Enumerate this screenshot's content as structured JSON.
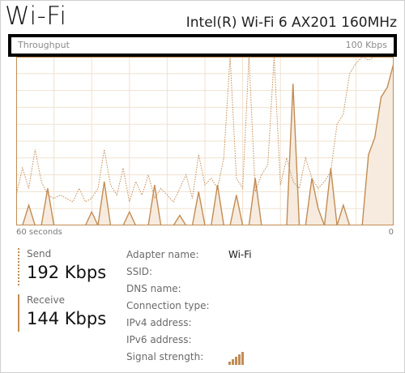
{
  "header": {
    "title": "Wi-Fi",
    "adapter_model": "Intel(R) Wi-Fi 6 AX201 160MHz"
  },
  "graph": {
    "label": "Throughput",
    "max_label": "100 Kbps",
    "time_left": "60 seconds",
    "time_right": "0",
    "line_color": "#c28c53",
    "fill_color": "#f6ebde",
    "grid_color": "#f0e1d0"
  },
  "chart_data": {
    "type": "line",
    "ylim": [
      0,
      100
    ],
    "x": [
      0,
      1,
      2,
      3,
      4,
      5,
      6,
      7,
      8,
      9,
      10,
      11,
      12,
      13,
      14,
      15,
      16,
      17,
      18,
      19,
      20,
      21,
      22,
      23,
      24,
      25,
      26,
      27,
      28,
      29,
      30,
      31,
      32,
      33,
      34,
      35,
      36,
      37,
      38,
      39,
      40,
      41,
      42,
      43,
      44,
      45,
      46,
      47,
      48,
      49,
      50,
      51,
      52,
      53,
      54,
      55,
      56,
      57,
      58,
      59,
      60
    ],
    "series": [
      {
        "name": "Send",
        "values": [
          18,
          34,
          22,
          45,
          26,
          18,
          16,
          18,
          16,
          14,
          22,
          14,
          16,
          22,
          45,
          24,
          18,
          34,
          14,
          26,
          18,
          30,
          16,
          22,
          18,
          14,
          22,
          30,
          16,
          42,
          24,
          28,
          22,
          40,
          100,
          28,
          22,
          100,
          20,
          30,
          36,
          100,
          24,
          40,
          26,
          22,
          40,
          28,
          22,
          26,
          32,
          60,
          66,
          90,
          96,
          100,
          98,
          100,
          100,
          100,
          100
        ]
      },
      {
        "name": "Receive",
        "values": [
          0,
          0,
          12,
          0,
          0,
          22,
          0,
          0,
          0,
          0,
          0,
          0,
          8,
          0,
          26,
          0,
          0,
          0,
          8,
          0,
          0,
          0,
          24,
          0,
          0,
          0,
          6,
          0,
          0,
          20,
          0,
          0,
          24,
          0,
          0,
          18,
          0,
          0,
          28,
          0,
          0,
          0,
          0,
          0,
          84,
          0,
          0,
          28,
          10,
          0,
          34,
          0,
          12,
          0,
          0,
          0,
          42,
          52,
          76,
          82,
          96
        ]
      }
    ]
  },
  "stats": {
    "send": {
      "label": "Send",
      "value": "192 Kbps"
    },
    "receive": {
      "label": "Receive",
      "value": "144 Kbps"
    }
  },
  "properties": {
    "adapter_name": {
      "label": "Adapter name:",
      "value": "Wi-Fi"
    },
    "ssid": {
      "label": "SSID:",
      "value": ""
    },
    "dns_name": {
      "label": "DNS name:",
      "value": ""
    },
    "connection_type": {
      "label": "Connection type:",
      "value": ""
    },
    "ipv4": {
      "label": "IPv4 address:",
      "value": ""
    },
    "ipv6": {
      "label": "IPv6 address:",
      "value": ""
    },
    "signal_strength": {
      "label": "Signal strength:",
      "bars": 5,
      "max_bars": 5,
      "icon": "signal-bars-icon"
    }
  }
}
